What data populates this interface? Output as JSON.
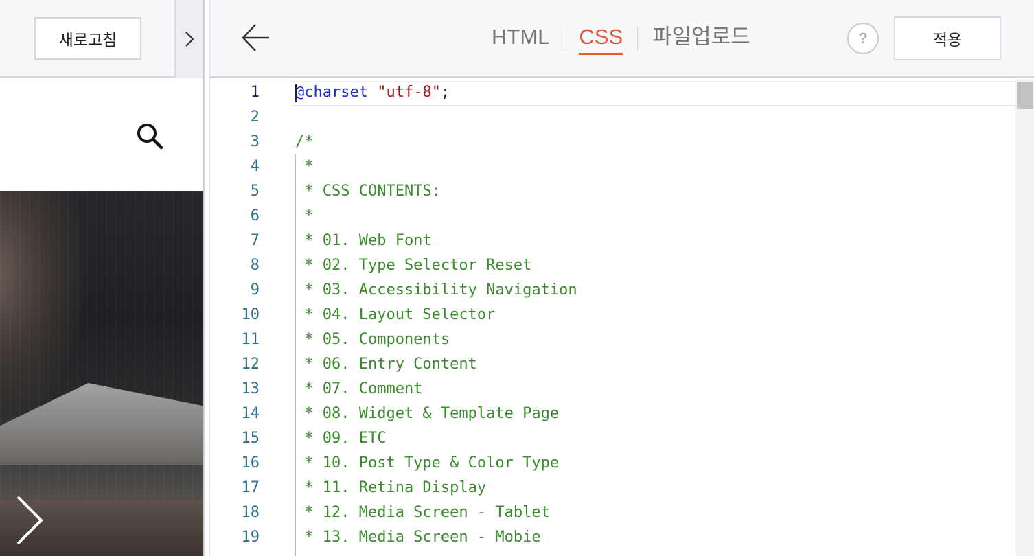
{
  "preview": {
    "refresh_label": "새로고침"
  },
  "editor": {
    "tabs": [
      {
        "label": "HTML",
        "active": false
      },
      {
        "label": "CSS",
        "active": true
      },
      {
        "label": "파일업로드",
        "active": false
      }
    ],
    "help_label": "?",
    "apply_label": "적용",
    "accent_color": "#e1573a",
    "lines": [
      {
        "n": "1",
        "tokens": [
          {
            "t": "@charset",
            "k": "at"
          },
          {
            "t": " ",
            "k": "punc"
          },
          {
            "t": "\"utf-8\"",
            "k": "str"
          },
          {
            "t": ";",
            "k": "punc"
          }
        ]
      },
      {
        "n": "2",
        "tokens": []
      },
      {
        "n": "3",
        "tokens": [
          {
            "t": "/*",
            "k": "comment"
          }
        ]
      },
      {
        "n": "4",
        "tokens": [
          {
            "t": " *",
            "k": "comment"
          }
        ]
      },
      {
        "n": "5",
        "tokens": [
          {
            "t": " * CSS CONTENTS:",
            "k": "comment"
          }
        ]
      },
      {
        "n": "6",
        "tokens": [
          {
            "t": " *",
            "k": "comment"
          }
        ]
      },
      {
        "n": "7",
        "tokens": [
          {
            "t": " * 01. Web Font",
            "k": "comment"
          }
        ]
      },
      {
        "n": "8",
        "tokens": [
          {
            "t": " * 02. Type Selector Reset",
            "k": "comment"
          }
        ]
      },
      {
        "n": "9",
        "tokens": [
          {
            "t": " * 03. Accessibility Navigation",
            "k": "comment"
          }
        ]
      },
      {
        "n": "10",
        "tokens": [
          {
            "t": " * 04. Layout Selector",
            "k": "comment"
          }
        ]
      },
      {
        "n": "11",
        "tokens": [
          {
            "t": " * 05. Components",
            "k": "comment"
          }
        ]
      },
      {
        "n": "12",
        "tokens": [
          {
            "t": " * 06. Entry Content",
            "k": "comment"
          }
        ]
      },
      {
        "n": "13",
        "tokens": [
          {
            "t": " * 07. Comment",
            "k": "comment"
          }
        ]
      },
      {
        "n": "14",
        "tokens": [
          {
            "t": " * 08. Widget & Template Page",
            "k": "comment"
          }
        ]
      },
      {
        "n": "15",
        "tokens": [
          {
            "t": " * 09. ETC",
            "k": "comment"
          }
        ]
      },
      {
        "n": "16",
        "tokens": [
          {
            "t": " * 10. Post Type & Color Type",
            "k": "comment"
          }
        ]
      },
      {
        "n": "17",
        "tokens": [
          {
            "t": " * 11. Retina Display",
            "k": "comment"
          }
        ]
      },
      {
        "n": "18",
        "tokens": [
          {
            "t": " * 12. Media Screen - Tablet",
            "k": "comment"
          }
        ]
      },
      {
        "n": "19",
        "tokens": [
          {
            "t": " * 13. Media Screen - Mobie",
            "k": "comment"
          }
        ]
      }
    ]
  },
  "icons": {
    "collapse": "chevron-right-icon",
    "search": "search-icon",
    "slider_next": "chevron-right-icon",
    "back": "arrow-left-icon",
    "help": "question-icon"
  }
}
